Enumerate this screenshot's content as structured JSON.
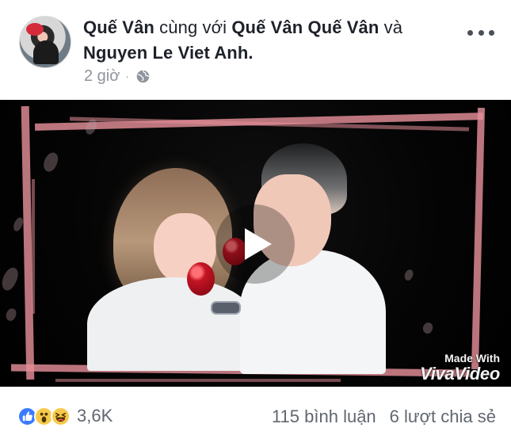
{
  "header": {
    "author": "Quế Vân",
    "with_text": "cùng với",
    "tagged_1": "Quế Vân Quế Vân",
    "and_text": "và",
    "tagged_2": "Nguyen Le Viet Anh",
    "suffix": ".",
    "time": "2 giờ",
    "separator": "·",
    "privacy_icon": "globe-icon",
    "menu_icon": "more-options-icon"
  },
  "video": {
    "watermark_line1": "Made With",
    "watermark_line2": "VivaVideo",
    "play_icon": "play-icon",
    "frame_color": "#e48e98"
  },
  "engagement": {
    "reactions": [
      "like-icon",
      "wow-icon",
      "haha-icon"
    ],
    "reaction_count": "3,6K",
    "comments": "115 bình luận",
    "shares": "6 lượt chia sẻ"
  },
  "colors": {
    "text": "#1d2129",
    "meta": "#90949c",
    "like": "#3b7cff",
    "emoji": "#f7c94a"
  }
}
